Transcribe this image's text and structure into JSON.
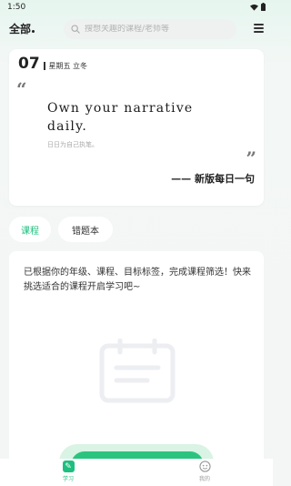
{
  "status_bar": {
    "time": "1:50"
  },
  "header": {
    "filter_label": "全部",
    "search_placeholder": "搜想关趣的课程/老师等"
  },
  "daily_quote": {
    "day": "07",
    "date_text": "星期五 立冬",
    "quote_en": "Own your narrative daily.",
    "quote_cn": "日日为自己执笔。",
    "author": "—— 新版每日一句"
  },
  "tabs": [
    {
      "label": "课程",
      "active": true
    },
    {
      "label": "错题本",
      "active": false
    }
  ],
  "course_panel": {
    "message": "已根据你的年级、课程、目标标签，完成课程筛选！快来挑选适合的课程开启学习吧~"
  },
  "bottom_nav": [
    {
      "label": "学习",
      "icon": "learn-icon",
      "active": true
    },
    {
      "label": "我的",
      "icon": "profile-icon",
      "active": false
    }
  ],
  "colors": {
    "accent": "#1dbf7f",
    "background": "#f4f6f5",
    "card": "#ffffff"
  }
}
